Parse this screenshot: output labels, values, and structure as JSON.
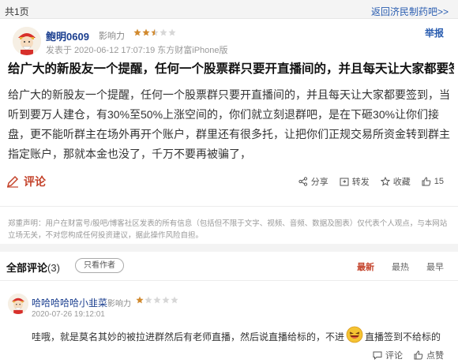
{
  "topbar": {
    "pages": "共1页",
    "back_link": "返回济民制药吧>>"
  },
  "post": {
    "author": "鲍明0609",
    "influence_label": "影响力",
    "influence_rating": 2.5,
    "meta": "发表于  2020-06-12 17:07:19 东方财富iPhone版",
    "report": "举报",
    "title": "给广大的新股友一个提醒，任何一个股票群只要开直播间的，并且每天让大家都要签到，当",
    "body": "给广大的新股友一个提醒，任何一个股票群只要开直播间的，并且每天让大家都要签到，当听到要万人建仓，有30%至50%上涨空间的，你们就立刻退群吧，是在下砸30%让你们接盘，更不能听群主在场外再开个账户，群里还有很多托，让把你们正规交易所资金转到群主指定账户，那就本金也没了，千万不要再被骗了，",
    "comment_label": "评论",
    "actions": {
      "share": "分享",
      "repost": "转发",
      "favorite": "收藏",
      "likes": "15"
    }
  },
  "disclaimer": "郑重声明：用户在财富号/股吧/博客社区发表的所有信息（包括但不限于文字、视频、音频、数据及图表）仅代表个人观点，与本网站立场无关，不对您构成任何投资建议，据此操作风险自担。",
  "comments_section": {
    "title": "全部评论",
    "count": "(3)",
    "only_author": "只看作者",
    "sort": {
      "newest": "最新",
      "hottest": "最热",
      "earliest": "最早"
    }
  },
  "comment": {
    "author": "哈哈哈哈哈小韭菜",
    "influence_label": "影响力",
    "influence_rating": 1,
    "time": "2020-07-26 19:12:01",
    "text_before": "哇哦，就是莫名其妙的被拉进群然后有老师直播，然后说直播给标的，不进",
    "text_after": "直播签到不给标的",
    "actions": {
      "comment": "评论",
      "like": "点赞"
    }
  },
  "colors": {
    "accent_red": "#c4432b",
    "link_blue": "#2a5db0",
    "star": "#d18a2f",
    "star_empty": "#d7d7d7"
  }
}
